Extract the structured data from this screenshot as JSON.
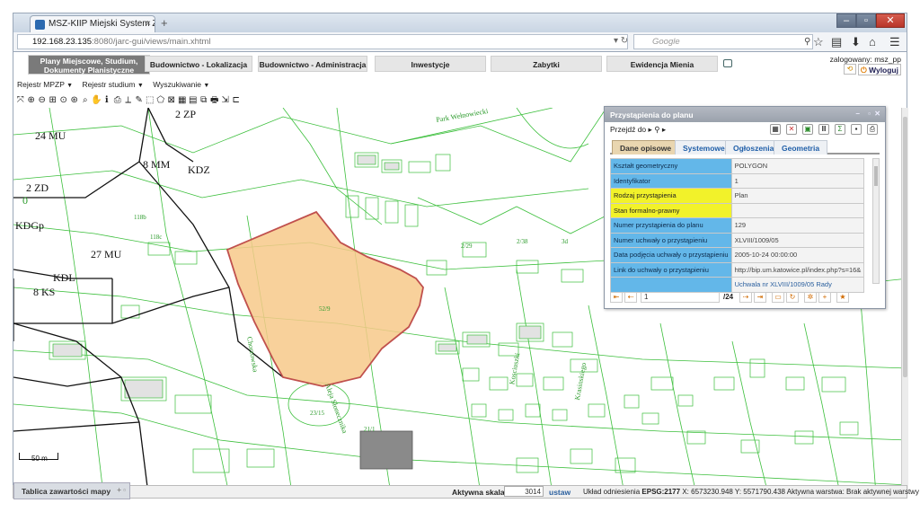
{
  "browser": {
    "tab_title": "MSZ-KIIP Miejski System Zarzą...",
    "url_host": "192.168.23.135",
    "url_rest": ":8080/jarc-gui/views/main.xhtml",
    "search_placeholder": "Google"
  },
  "header": {
    "menu": [
      {
        "label": "Plany Miejscowe, Studium, Dokumenty Planistyczne"
      },
      {
        "label": "Budownictwo - Lokalizacja"
      },
      {
        "label": "Budownictwo - Administracja"
      },
      {
        "label": "Inwestycje"
      },
      {
        "label": "Zabytki"
      },
      {
        "label": "Ewidencja Mienia"
      }
    ],
    "user_label": "zalogowany: msz_pp",
    "logout_label": "Wyloguj"
  },
  "toolbar": {
    "dropdowns": [
      {
        "label": "Rejestr MPZP"
      },
      {
        "label": "Rejestr studium"
      },
      {
        "label": "Wyszukiwanie"
      }
    ]
  },
  "map": {
    "zone_labels": [
      {
        "text": "24 MU"
      },
      {
        "text": "2 ZP"
      },
      {
        "text": "8 MM"
      },
      {
        "text": "KDZ"
      },
      {
        "text": "0"
      },
      {
        "text": "2 ZD"
      },
      {
        "text": "KDGp"
      },
      {
        "text": "27 MU"
      },
      {
        "text": "KDL"
      },
      {
        "text": "8 KS"
      }
    ],
    "streets": [
      {
        "text": "Park Wełnowiecki"
      },
      {
        "text": "Kosciuszki"
      },
      {
        "text": "Krasinskiego"
      },
      {
        "text": "Aleja Słonecznika"
      },
      {
        "text": "Chorzowska"
      }
    ],
    "parcels": [
      {
        "text": "52/9"
      },
      {
        "text": "118c"
      },
      {
        "text": "118b"
      },
      {
        "text": "2/29"
      },
      {
        "text": "23/15"
      },
      {
        "text": "3d"
      },
      {
        "text": "2/38"
      },
      {
        "text": "21/1"
      }
    ],
    "scale_bar_label": "50 m",
    "highlight_color": "#f7c98a",
    "highlight_border": "#c0504d",
    "line_color": "#3cbf3c"
  },
  "panel": {
    "title": "Przystąpienia do planu",
    "goto_label": "Przejdź do",
    "tabs": [
      {
        "label": "Dane opisowe",
        "active": true
      },
      {
        "label": "Systemowe",
        "active": false
      },
      {
        "label": "Ogłoszenia",
        "active": false
      },
      {
        "label": "Geometria",
        "active": false
      }
    ],
    "rows": [
      {
        "key": "Kształt geometryczny",
        "value": "POLYGON",
        "required": false
      },
      {
        "key": "Identyfikator",
        "value": "1",
        "required": false
      },
      {
        "key": "Rodzaj przystąpienia",
        "value": "Plan",
        "required": true
      },
      {
        "key": "Stan formalno-prawny",
        "value": "",
        "required": true
      },
      {
        "key": "Numer przystąpienia do planu",
        "value": "129",
        "required": false
      },
      {
        "key": "Numer uchwały o przystąpieniu",
        "value": "XLVIII/1009/05",
        "required": false
      },
      {
        "key": "Data podjęcia uchwały o przystąpieniu",
        "value": "2005-10-24 00:00:00",
        "required": false
      },
      {
        "key": "Link do uchwały o przystąpieniu",
        "value": "http://bip.um.katowice.pl/index.php?s=16&",
        "required": false
      },
      {
        "key": "",
        "value": "Uchwala nr XLVIII/1009/05 Rady",
        "required": false,
        "link": true
      }
    ],
    "pager_value": "1",
    "pager_total": "/24"
  },
  "statusbar": {
    "legend_tab": "Tablica zawartości mapy",
    "scale_label": "Aktywna skala:",
    "scale_value": "3014",
    "scale_set": "ustaw",
    "crs_label": "Układ odniesienia",
    "crs_value": "EPSG:2177",
    "x_label": "X:",
    "x_value": "6573230.948",
    "y_label": "Y:",
    "y_value": "5571790.438",
    "layer_label": "Aktywna warstwa:",
    "layer_value": "Brak aktywnej warstwy"
  }
}
